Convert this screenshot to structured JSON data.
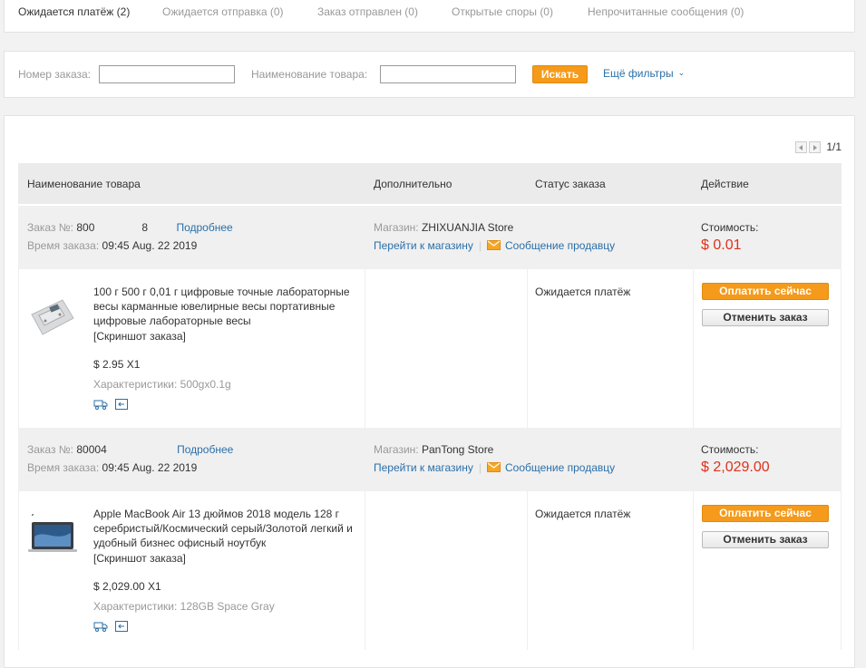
{
  "tabs": [
    {
      "label": "Ожидается платёж (2)"
    },
    {
      "label": "Ожидается отправка (0)"
    },
    {
      "label": "Заказ отправлен (0)"
    },
    {
      "label": "Открытые споры (0)"
    },
    {
      "label": "Непрочитанные сообщения (0)"
    }
  ],
  "filters": {
    "order_no_label": "Номер заказа:",
    "order_no_value": "",
    "product_name_label": "Наименование товара:",
    "product_name_value": "",
    "search_label": "Искать",
    "more_filters_label": "Ещё фильтры"
  },
  "pagination": {
    "text": "1/1"
  },
  "table_headers": {
    "product": "Наименование товара",
    "extra": "Дополнительно",
    "status": "Статус заказа",
    "action": "Действие"
  },
  "orders": [
    {
      "order_label": "Заказ №:",
      "order_number_prefix": "800",
      "order_number_suffix": "8",
      "details_link": "Подробнее",
      "time_label": "Время заказа:",
      "time_value": "09:45 Aug. 22 2019",
      "store_label": "Магазин:",
      "store_name": "ZHIXUANJIA Store",
      "go_to_store": "Перейти к магазину",
      "message_seller": "Сообщение продавцу",
      "cost_label": "Стоимость:",
      "cost_value": "$ 0.01",
      "product_name": "100 г 500 г 0,01 г цифровые точные лабораторные весы карманные ювелирные весы портативные цифровые лабораторные весы",
      "snapshot": "[Скриншот заказа]",
      "price_qty": "$ 2.95 X1",
      "spec_label": "Характеристики:",
      "spec_value": "500gx0.1g",
      "status": "Ожидается платёж",
      "pay_now": "Оплатить сейчас",
      "cancel_order": "Отменить заказ"
    },
    {
      "order_label": "Заказ №:",
      "order_number_prefix": "80004",
      "order_number_suffix": "",
      "details_link": "Подробнее",
      "time_label": "Время заказа:",
      "time_value": "09:45 Aug. 22 2019",
      "store_label": "Магазин:",
      "store_name": "PanTong Store",
      "go_to_store": "Перейти к магазину",
      "message_seller": "Сообщение продавцу",
      "cost_label": "Стоимость:",
      "cost_value": "$ 2,029.00",
      "product_name": "Apple MacBook Air 13 дюймов 2018 модель 128 г серебристый/Космический серый/Золотой легкий и удобный бизнес офисный ноутбук",
      "snapshot": "[Скриншот заказа]",
      "price_qty": "$ 2,029.00 X1",
      "spec_label": "Характеристики:",
      "spec_value": "128GB Space Gray",
      "status": "Ожидается платёж",
      "pay_now": "Оплатить сейчас",
      "cancel_order": "Отменить заказ"
    }
  ],
  "colors": {
    "accent_orange": "#f59a1a",
    "link_blue": "#2a6fa8",
    "price_red": "#e0321b"
  },
  "icons": [
    "chevron-down-icon",
    "prev-page-icon",
    "next-page-icon",
    "mail-icon",
    "shipping-truck-icon",
    "return-icon",
    "product-thumbnail"
  ]
}
